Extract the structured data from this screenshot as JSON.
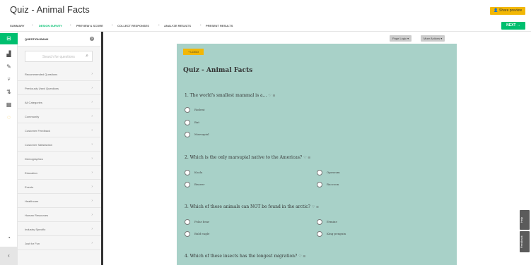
{
  "app": {
    "title": "Quiz - Animal Facts",
    "share_label": "Share preview"
  },
  "steps": {
    "items": [
      "SUMMARY",
      "DESIGN SURVEY",
      "PREVIEW & SCORE",
      "COLLECT RESPONSES",
      "ANALYZE RESULTS",
      "PRESENT RESULTS"
    ],
    "active": "DESIGN SURVEY",
    "next_label": "NEXT"
  },
  "rail": {
    "icons": [
      "question-bank-icon",
      "builder-icon",
      "edit-icon",
      "logic-icon",
      "options-icon",
      "print-icon",
      "tag-icon"
    ]
  },
  "bank": {
    "heading": "QUESTION BANK",
    "help": "?",
    "search_placeholder": "Search for questions",
    "categories": [
      "Recommended Questions",
      "Previously Used Questions",
      "All Categories",
      "Community",
      "Customer Feedback",
      "Customer Satisfaction",
      "Demographics",
      "Education",
      "Events",
      "Healthcare",
      "Human Resources",
      "Industry Specific",
      "Just for Fun"
    ]
  },
  "toolbar": {
    "page_logic": "Page Logic",
    "more_actions": "More Actions"
  },
  "survey": {
    "logo_label": "+ LOGO",
    "title": "Quiz - Animal Facts",
    "questions": [
      {
        "text": "1. The world's smallest mammal is a...",
        "options": [
          "Rodent",
          "Bat",
          "Marsupial"
        ]
      },
      {
        "text": "2. Which is the only marsupial native to the Americas?",
        "options": [
          "Koala",
          "Opossum",
          "Beaver",
          "Raccoon"
        ]
      },
      {
        "text": "3. Which of these animals can NOT be found in the arctic?",
        "options": [
          "Polar bear",
          "Ermine",
          "Bald eagle",
          "King penguin"
        ]
      },
      {
        "text": "4. Which of these insects has the longest migration?"
      }
    ]
  },
  "side_tabs": {
    "help": "Help",
    "feedback": "Feedback"
  },
  "colors": {
    "brand_green": "#00bf6f",
    "accent_yellow": "#f2b705",
    "survey_bg": "#a8d1c8"
  }
}
